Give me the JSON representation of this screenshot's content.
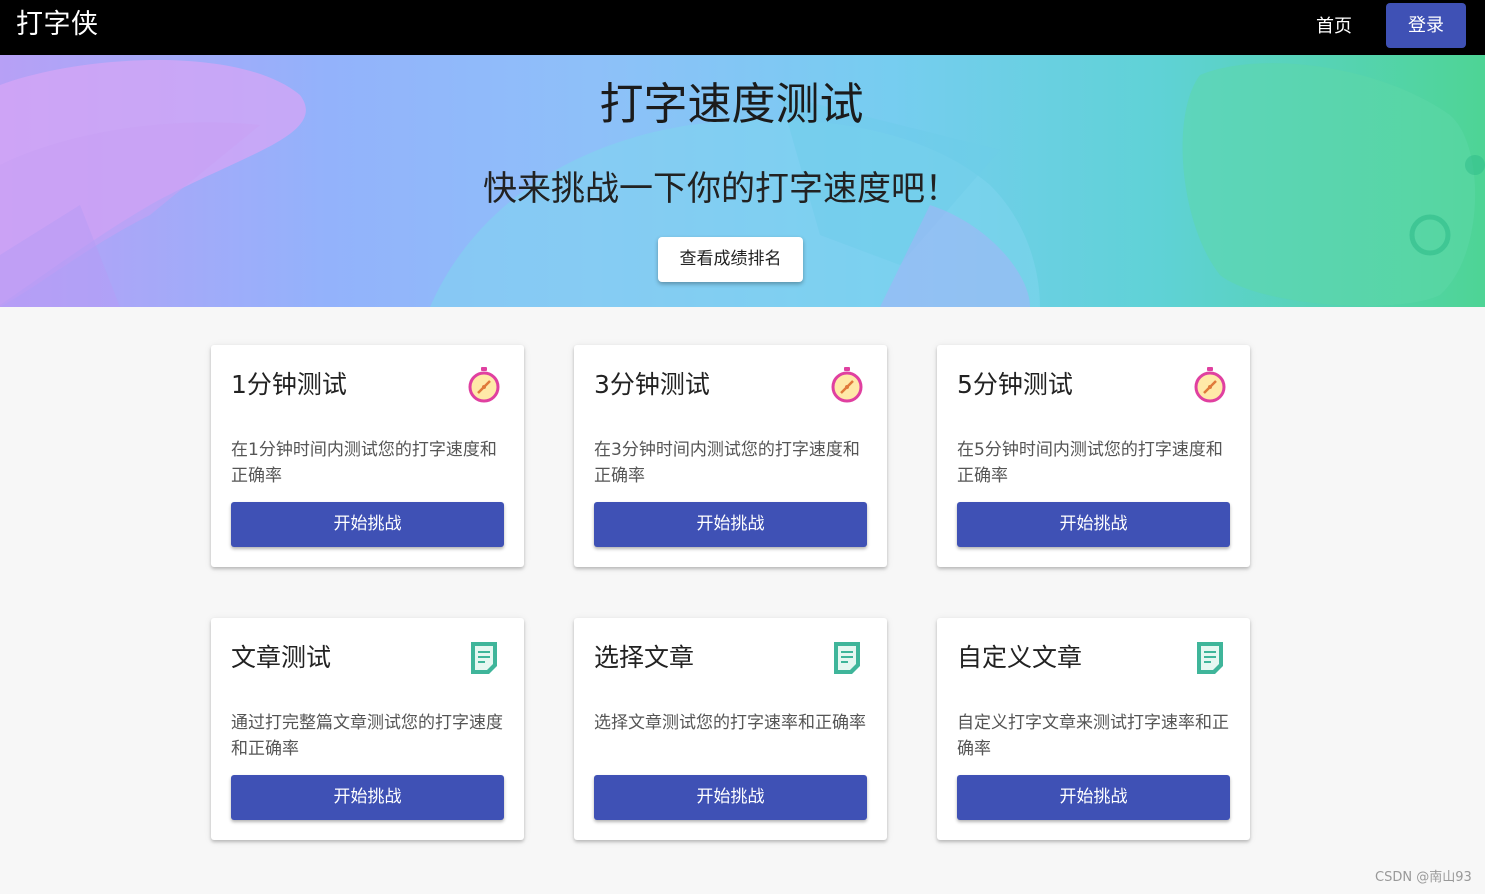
{
  "navbar": {
    "brand": "打字侠",
    "home_label": "首页",
    "login_label": "登录"
  },
  "hero": {
    "title": "打字速度测试",
    "subtitle": "快来挑战一下你的打字速度吧！",
    "rank_button": "查看成绩排名"
  },
  "cards": [
    {
      "title": "1分钟测试",
      "icon": "stopwatch-icon",
      "desc": "在1分钟时间内测试您的打字速度和正确率",
      "button": "开始挑战"
    },
    {
      "title": "3分钟测试",
      "icon": "stopwatch-icon",
      "desc": "在3分钟时间内测试您的打字速度和正确率",
      "button": "开始挑战"
    },
    {
      "title": "5分钟测试",
      "icon": "stopwatch-icon",
      "desc": "在5分钟时间内测试您的打字速度和正确率",
      "button": "开始挑战"
    },
    {
      "title": "文章测试",
      "icon": "document-icon",
      "desc": "通过打完整篇文章测试您的打字速度和正确率",
      "button": "开始挑战"
    },
    {
      "title": "选择文章",
      "icon": "document-icon",
      "desc": "选择文章测试您的打字速率和正确率",
      "button": "开始挑战"
    },
    {
      "title": "自定义文章",
      "icon": "document-icon",
      "desc": "自定义打字文章来测试打字速率和正确率",
      "button": "开始挑战"
    }
  ],
  "colors": {
    "navbar": "#000000",
    "primary": "#3f51b5",
    "stopwatch_ring": "#e040a0",
    "stopwatch_fill": "#ffe9a8",
    "document": "#3fb59a"
  },
  "watermark": "CSDN @南山93"
}
